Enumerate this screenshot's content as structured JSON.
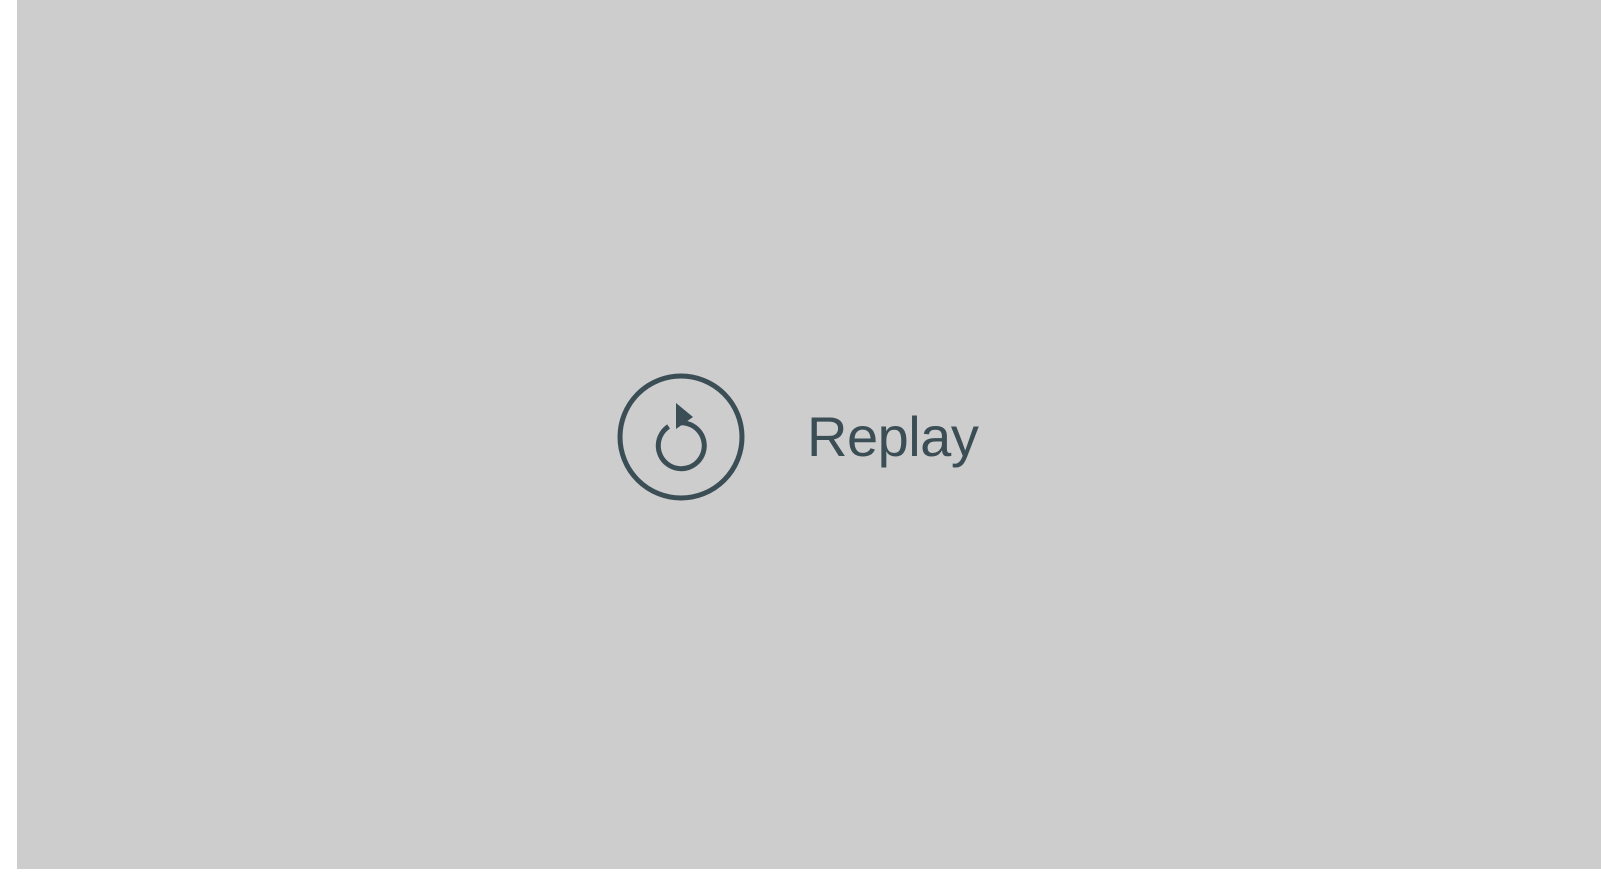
{
  "replay": {
    "label": "Replay",
    "icon": "replay-icon"
  },
  "colors": {
    "background": "#cdcdcd",
    "accent": "#3b4d55",
    "margin": "#ffffff"
  }
}
